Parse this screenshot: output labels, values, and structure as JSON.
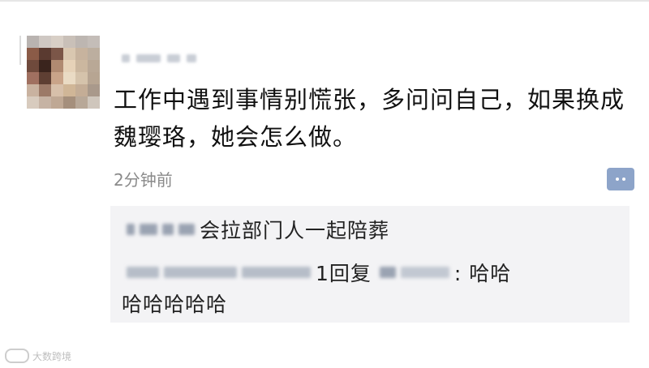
{
  "post": {
    "text": "工作中遇到事情别慌张，多问问自己，如果换成魏璎珞，她会怎么做。",
    "time": "2分钟前"
  },
  "comments": {
    "first": "会拉部门人一起陪葬",
    "reply_label": "1回复",
    "reply_text_line1": ": 哈哈",
    "reply_text_line2": "哈哈哈哈哈"
  },
  "watermark": {
    "text": "大数跨境"
  },
  "colors": {
    "comment_bg": "#f3f3f5",
    "comment_button": "#8da4c9",
    "time_text": "#8a8a8a"
  },
  "icons": {
    "comment_button": "comment-bubble-icon"
  }
}
